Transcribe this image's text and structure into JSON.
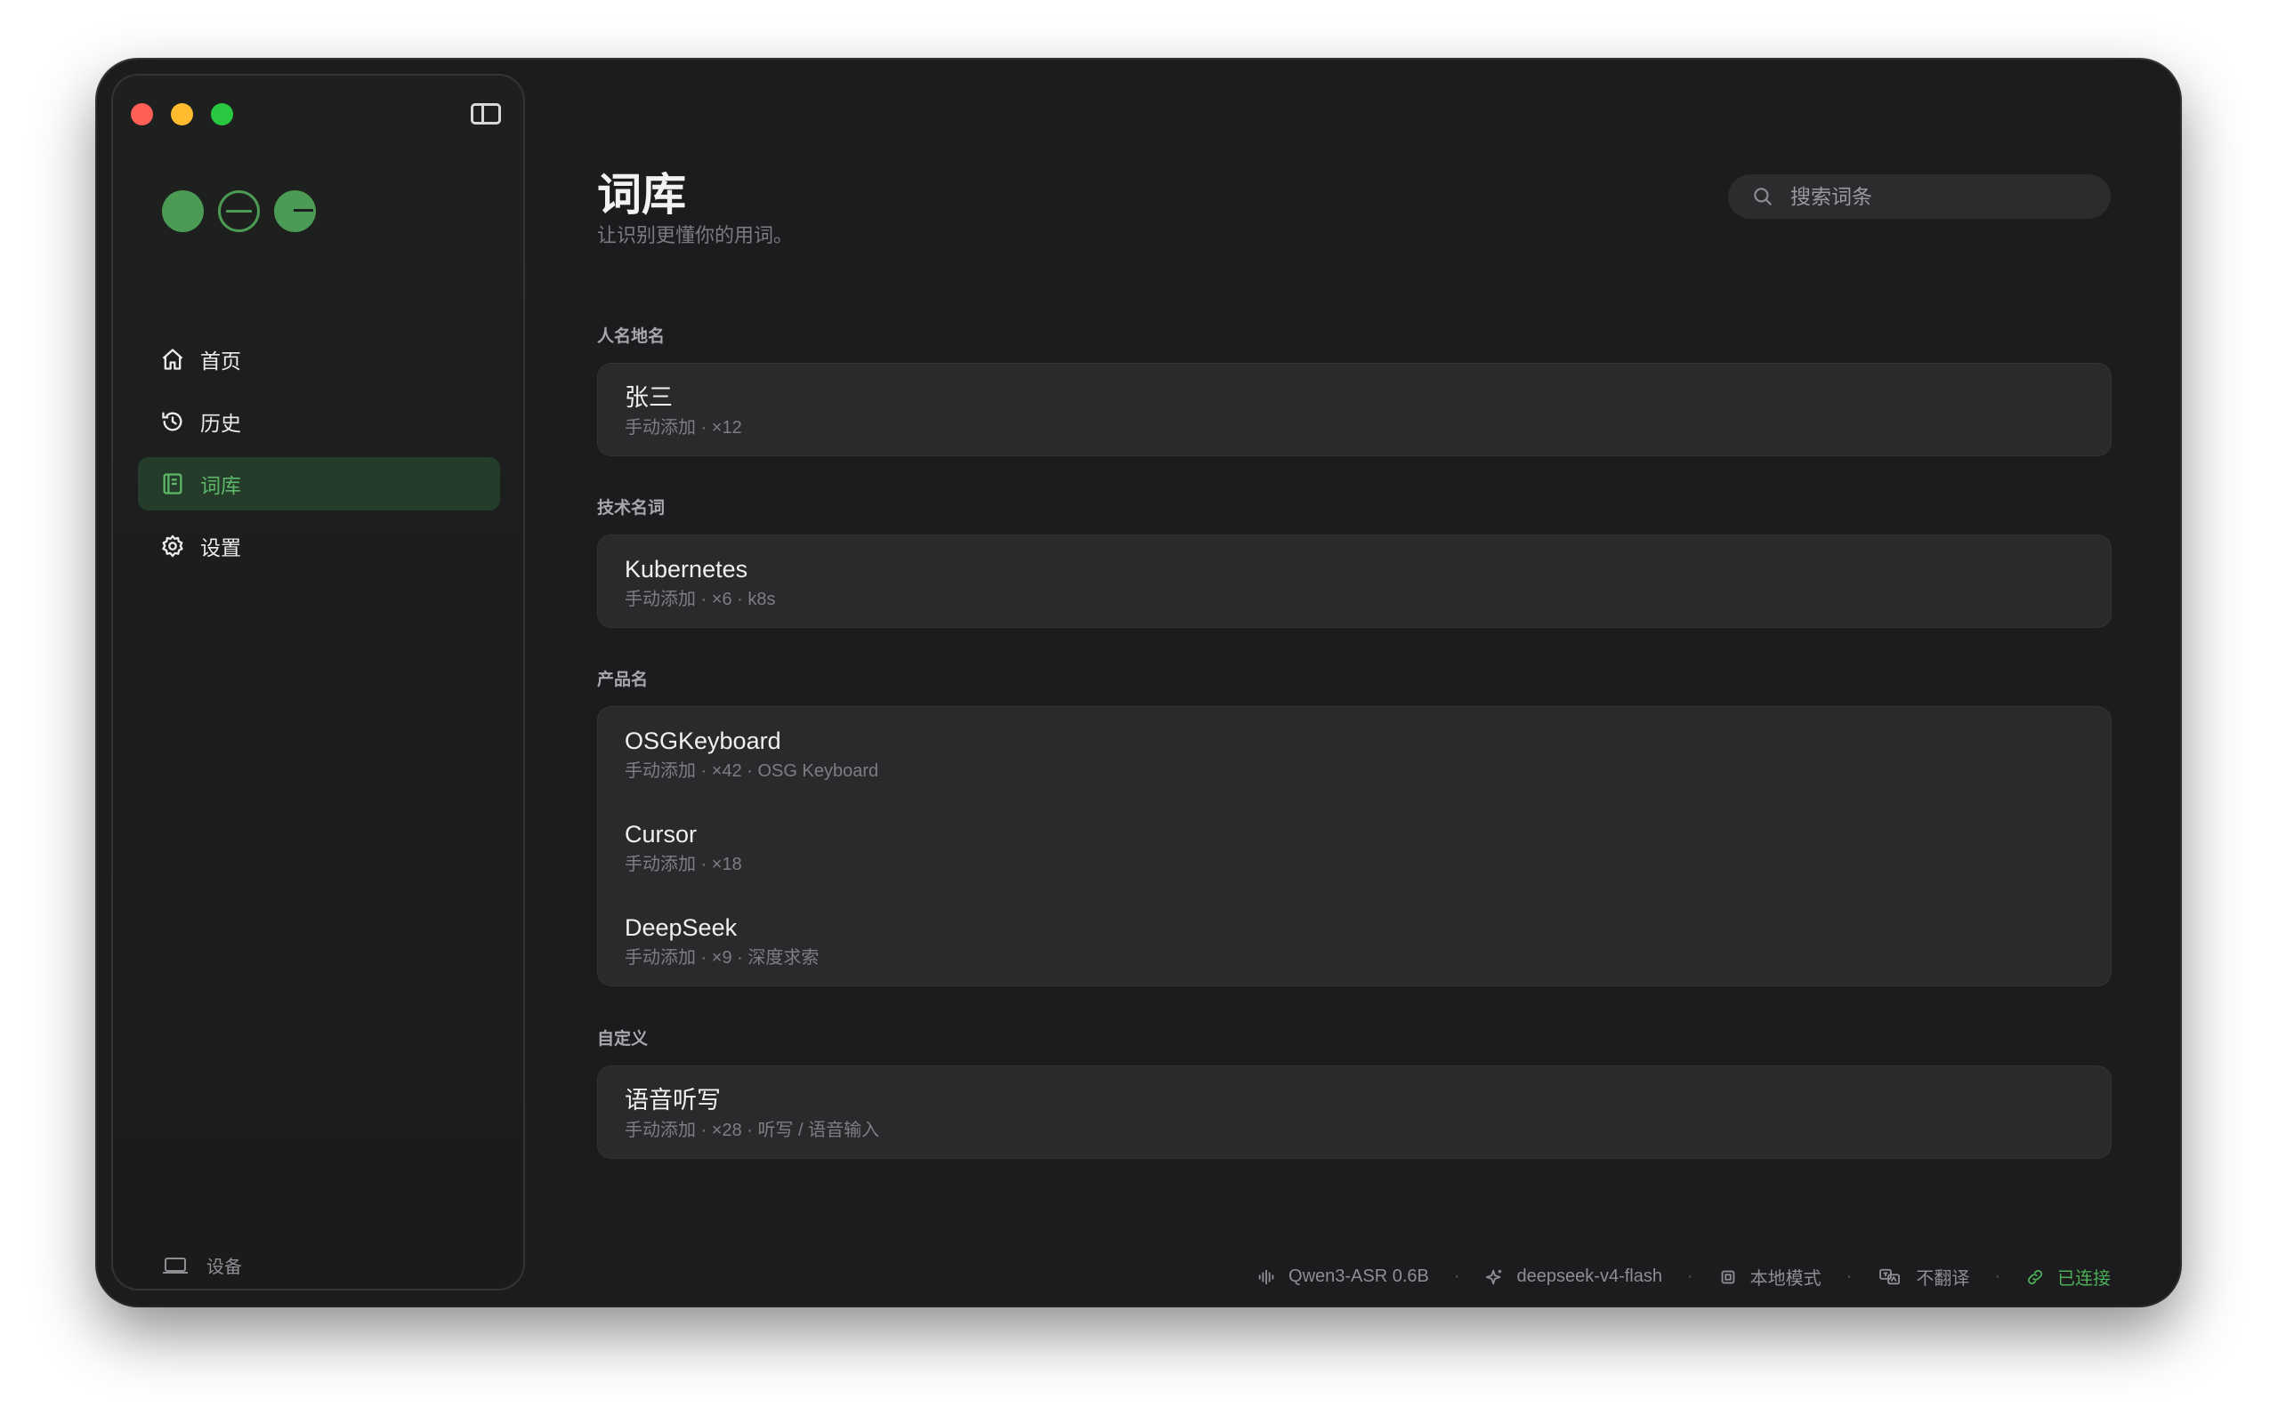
{
  "sidebar": {
    "nav": [
      {
        "label": "首页",
        "icon": "home-icon"
      },
      {
        "label": "历史",
        "icon": "history-icon"
      },
      {
        "label": "词库",
        "icon": "book-icon",
        "active": true
      },
      {
        "label": "设置",
        "icon": "gear-icon"
      }
    ],
    "device_label": "设备"
  },
  "header": {
    "title": "词库",
    "subtitle": "让识别更懂你的用词。",
    "search_placeholder": "搜索词条"
  },
  "groups": [
    {
      "label": "人名地名",
      "entries": [
        {
          "name": "张三",
          "meta": "手动添加 · ×12"
        }
      ]
    },
    {
      "label": "技术名词",
      "entries": [
        {
          "name": "Kubernetes",
          "meta": "手动添加 · ×6 · k8s"
        }
      ]
    },
    {
      "label": "产品名",
      "entries": [
        {
          "name": "OSGKeyboard",
          "meta": "手动添加 · ×42 · OSG Keyboard"
        },
        {
          "name": "Cursor",
          "meta": "手动添加 · ×18"
        },
        {
          "name": "DeepSeek",
          "meta": "手动添加 · ×9 · 深度求索"
        }
      ]
    },
    {
      "label": "自定义",
      "entries": [
        {
          "name": "语音听写",
          "meta": "手动添加 · ×28 · 听写 / 语音输入"
        }
      ]
    }
  ],
  "status": {
    "asr_model": "Qwen3-ASR 0.6B",
    "llm_model": "deepseek-v4-flash",
    "mode": "本地模式",
    "translate": "不翻译",
    "connection": "已连接",
    "separator": "·"
  },
  "colors": {
    "accent": "#4c9b55",
    "active_bg": "#253c2a",
    "connected": "#4caf57",
    "window_bg": "#1c1c1e",
    "card_bg": "#2a2a2c"
  }
}
